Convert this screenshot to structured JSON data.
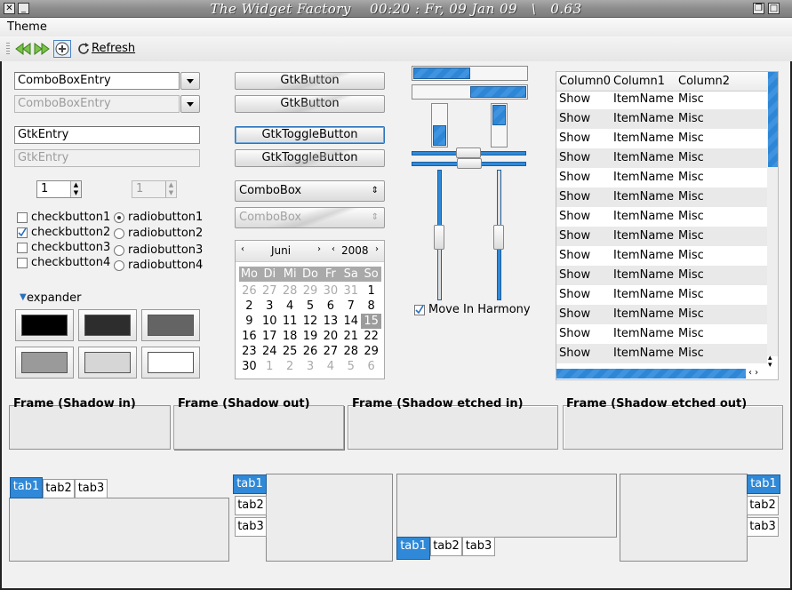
{
  "window": {
    "title": "The Widget Factory    00:20 : Fr, 09 Jan 09   \\   0.63"
  },
  "menubar": {
    "theme": "Theme"
  },
  "toolbar": {
    "refresh": "Refresh"
  },
  "left": {
    "combo_entry": "ComboBoxEntry",
    "combo_entry_disabled": "ComboBoxEntry",
    "entry": "GtkEntry",
    "entry_disabled": "GtkEntry",
    "spin_value": "1",
    "spin_disabled_value": "1",
    "checks": [
      "checkbutton1",
      "checkbutton2",
      "checkbutton3",
      "checkbutton4"
    ],
    "radios": [
      "radiobutton1",
      "radiobutton2",
      "radiobutton3",
      "radiobutton4"
    ],
    "expander": "expander"
  },
  "middle": {
    "button1": "GtkButton",
    "button2": "GtkButton",
    "toggle1": "GtkToggleButton",
    "toggle2": "GtkToggleButton",
    "combobox": "ComboBox",
    "combobox_disabled": "ComboBox"
  },
  "calendar": {
    "month": "Juni",
    "year": "2008",
    "weekdays": [
      "Mo",
      "Di",
      "Mi",
      "Do",
      "Fr",
      "Sa",
      "So"
    ],
    "weeks": [
      [
        "26",
        "27",
        "28",
        "29",
        "30",
        "31",
        "1"
      ],
      [
        "2",
        "3",
        "4",
        "5",
        "6",
        "7",
        "8"
      ],
      [
        "9",
        "10",
        "11",
        "12",
        "13",
        "14",
        "15"
      ],
      [
        "16",
        "17",
        "18",
        "19",
        "20",
        "21",
        "22"
      ],
      [
        "23",
        "24",
        "25",
        "26",
        "27",
        "28",
        "29"
      ],
      [
        "30",
        "1",
        "2",
        "3",
        "4",
        "5",
        "6"
      ]
    ],
    "selected": "15"
  },
  "scales": {
    "hprogress1": 0.5,
    "hprogress2": 0.5,
    "vprogress1": 0.5,
    "vprogress2": 0.5,
    "harmony": "Move In Harmony"
  },
  "tree": {
    "columns": [
      "Column0",
      "Column1",
      "Column2"
    ],
    "rows": [
      [
        "Show",
        "ItemName",
        "Misc"
      ],
      [
        "Show",
        "ItemName",
        "Misc"
      ],
      [
        "Show",
        "ItemName",
        "Misc"
      ],
      [
        "Show",
        "ItemName",
        "Misc"
      ],
      [
        "Show",
        "ItemName",
        "Misc"
      ],
      [
        "Show",
        "ItemName",
        "Misc"
      ],
      [
        "Show",
        "ItemName",
        "Misc"
      ],
      [
        "Show",
        "ItemName",
        "Misc"
      ],
      [
        "Show",
        "ItemName",
        "Misc"
      ],
      [
        "Show",
        "ItemName",
        "Misc"
      ],
      [
        "Show",
        "ItemName",
        "Misc"
      ],
      [
        "Show",
        "ItemName",
        "Misc"
      ],
      [
        "Show",
        "ItemName",
        "Misc"
      ],
      [
        "Show",
        "ItemName",
        "Misc"
      ]
    ]
  },
  "frames": [
    "Frame (Shadow in)",
    "Frame (Shadow out)",
    "Frame (Shadow etched in)",
    "Frame (Shadow etched out)"
  ],
  "tabs": [
    "tab1",
    "tab2",
    "tab3"
  ],
  "colors": {
    "accent": "#2f89d8",
    "title_bg": "#8c8c8c"
  }
}
